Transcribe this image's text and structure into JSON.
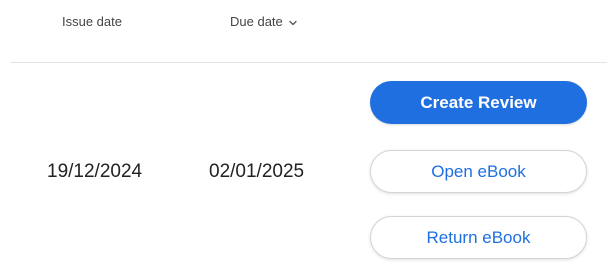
{
  "table": {
    "headers": {
      "issue_date": "Issue date",
      "due_date": "Due date",
      "due_date_icon": "chevron-down-icon"
    },
    "row": {
      "issue_date": "19/12/2024",
      "due_date": "02/01/2025"
    }
  },
  "actions": {
    "create_review": "Create Review",
    "open_ebook": "Open eBook",
    "return_ebook": "Return eBook"
  },
  "colors": {
    "accent": "#1f6fe0",
    "text": "#222222",
    "header_text": "#444444",
    "divider": "#e3e3e3"
  }
}
